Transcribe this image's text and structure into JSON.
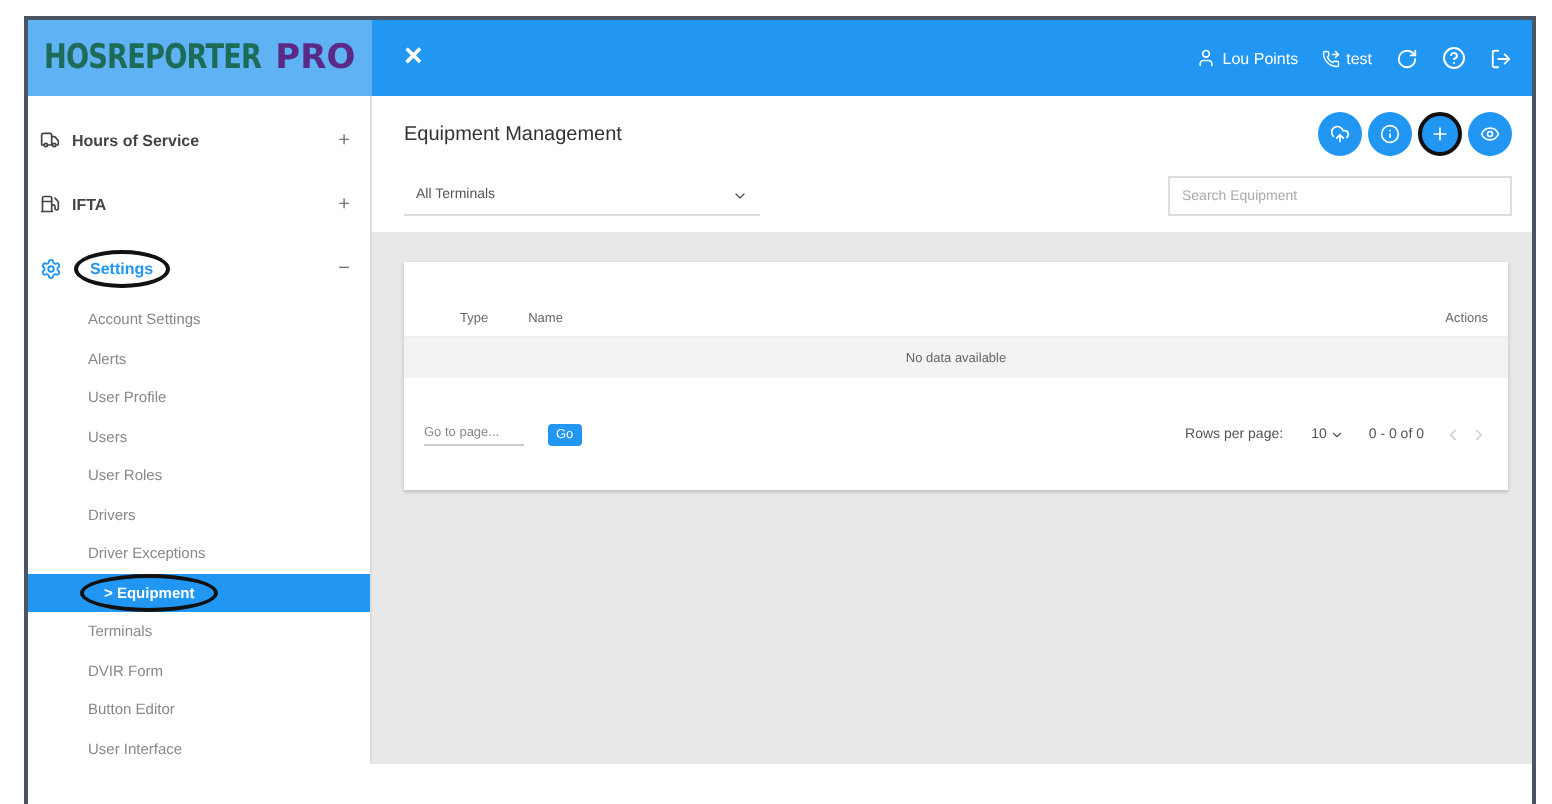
{
  "header": {
    "logo_main": "HOSREPORTER",
    "logo_accent": "PRO",
    "close": "×",
    "user": "Lou Points",
    "phone": "test"
  },
  "sidebar": {
    "items": [
      {
        "kind": "truck",
        "label": "Hours of Service",
        "toggle": "+",
        "expanded": false,
        "circled": false
      },
      {
        "kind": "fuel",
        "label": "IFTA",
        "toggle": "+",
        "expanded": false,
        "circled": false
      },
      {
        "kind": "gear",
        "label": "Settings",
        "toggle": "−",
        "expanded": true,
        "circled": true,
        "children": [
          {
            "label": "Account Settings",
            "selected": false,
            "circled": false
          },
          {
            "label": "Alerts",
            "selected": false,
            "circled": false
          },
          {
            "label": "User Profile",
            "selected": false,
            "circled": false
          },
          {
            "label": "Users",
            "selected": false,
            "circled": false
          },
          {
            "label": "User Roles",
            "selected": false,
            "circled": false
          },
          {
            "label": "Drivers",
            "selected": false,
            "circled": false
          },
          {
            "label": "Driver Exceptions",
            "selected": false,
            "circled": false
          },
          {
            "label": "Equipment",
            "marker": ">",
            "selected": true,
            "circled": true
          },
          {
            "label": "Terminals",
            "selected": false,
            "circled": false
          },
          {
            "label": "DVIR Form",
            "selected": false,
            "circled": false
          },
          {
            "label": "Button Editor",
            "selected": false,
            "circled": false
          },
          {
            "label": "User Interface",
            "selected": false,
            "circled": false
          }
        ]
      }
    ]
  },
  "page": {
    "title": "Equipment Management",
    "action_buttons": [
      {
        "kind": "cloud",
        "circled": false
      },
      {
        "kind": "info",
        "circled": false
      },
      {
        "kind": "add",
        "circled": true
      },
      {
        "kind": "view",
        "circled": false
      }
    ],
    "terminal_select": {
      "value": "All Terminals"
    },
    "search": {
      "placeholder": "Search Equipment"
    },
    "table": {
      "columns": [
        "Type",
        "Name"
      ],
      "actions_column": "Actions",
      "empty": "No data available",
      "goto_placeholder": "Go to page...",
      "go": "Go",
      "rows_per_page_label": "Rows per page:",
      "rows_per_page": "10",
      "range": "0 - 0 of 0"
    }
  }
}
